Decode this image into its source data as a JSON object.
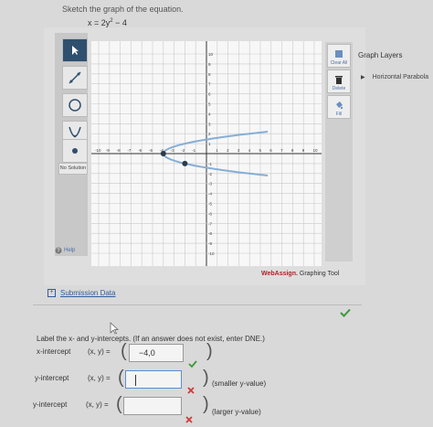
{
  "header": {
    "prompt": "Sketch the graph of the equation.",
    "equation_lhs": "x = 2y",
    "equation_exp": "2",
    "equation_rhs": " − 4"
  },
  "toolbar": {
    "tools": [
      "pointer-icon",
      "line-icon",
      "circle-icon",
      "parabola-icon",
      "point-icon"
    ],
    "no_solution": "No Solution",
    "help": "Help"
  },
  "graph": {
    "x_range": [
      -10,
      10
    ],
    "y_range": [
      -10,
      10
    ],
    "x_tick_labels": [
      "-10",
      "-9",
      "-8",
      "-7",
      "-6",
      "-5",
      "-4",
      "-3",
      "-2",
      "-1",
      "1",
      "2",
      "3",
      "4",
      "5",
      "6",
      "7",
      "8",
      "9",
      "10"
    ],
    "y_tick_labels": [
      "10",
      "9",
      "8",
      "7",
      "6",
      "5",
      "4",
      "3",
      "2",
      "1",
      "-1",
      "-2",
      "-3",
      "-4",
      "-5",
      "-6",
      "-7",
      "-8",
      "-9",
      "-10"
    ],
    "curve_color": "#86aed6",
    "vertex": [
      -4,
      0
    ],
    "second_point": [
      -2,
      -1
    ]
  },
  "right_panel": {
    "clear_all": "Clear All",
    "delete": "Delete",
    "fill": "Fill"
  },
  "layers": {
    "title": "Graph Layers",
    "item": "Horizontal Parabola"
  },
  "brand": {
    "name": "WebAssign.",
    "suffix": " Graphing Tool"
  },
  "submission": {
    "label": "Submission Data"
  },
  "question": {
    "text": "Label the x- and y-intercepts. (If an answer does not exist, enter DNE.)",
    "rows": [
      {
        "label": "x-intercept",
        "xy": "(x, y) =",
        "value": "−4,0",
        "note": ""
      },
      {
        "label": "y-intercept",
        "xy": "(x, y) =",
        "value": "",
        "note": "(smaller y-value)"
      },
      {
        "label": "y-intercept",
        "xy": "(x, y) =",
        "value": "",
        "note": "(larger y-value)"
      }
    ]
  },
  "colors": {
    "check": "#3a9a3a",
    "cross": "#d23a3a",
    "link": "#2f5d9e"
  }
}
